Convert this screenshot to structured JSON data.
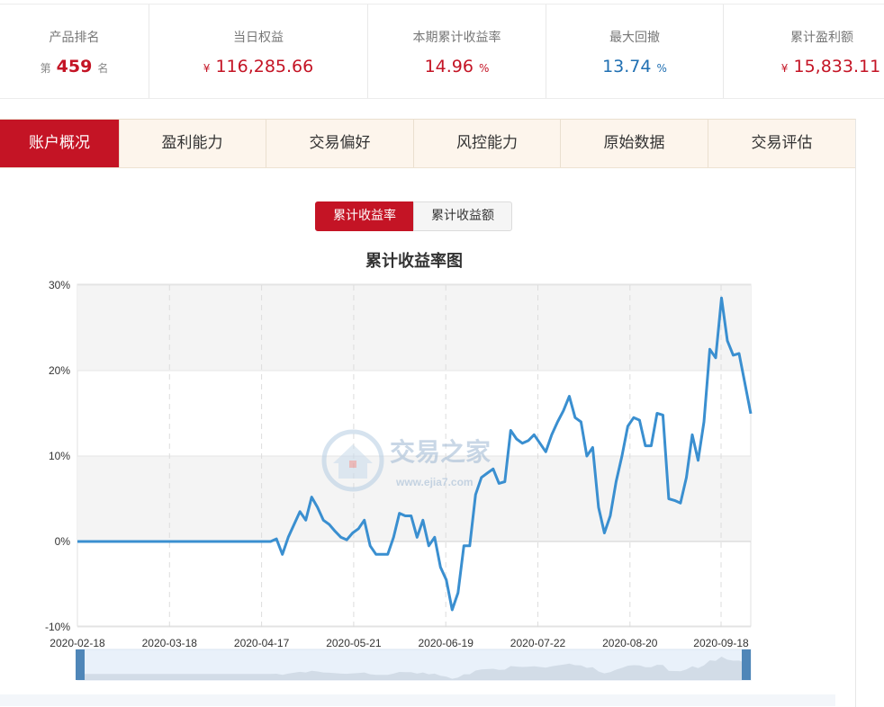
{
  "stats": {
    "rank": {
      "label": "产品排名",
      "prefix": "第",
      "value": "459",
      "suffix": "名"
    },
    "equity": {
      "label": "当日权益",
      "currency": "¥",
      "value": "116,285.66"
    },
    "cum_return": {
      "label": "本期累计收益率",
      "value": "14.96",
      "unit": "%"
    },
    "max_drawdown": {
      "label": "最大回撤",
      "value": "13.74",
      "unit": "%"
    },
    "cum_profit": {
      "label": "累计盈利额",
      "currency": "¥",
      "value": "15,833.11"
    }
  },
  "tabs": [
    "账户概况",
    "盈利能力",
    "交易偏好",
    "风控能力",
    "原始数据",
    "交易评估"
  ],
  "active_tab": 0,
  "toggle": {
    "rate": "累计收益率",
    "amount": "累计收益额"
  },
  "watermark": {
    "name": "交易之家",
    "url": "www.ejia7.com"
  },
  "colors": {
    "accent": "#c41425",
    "line": "#3a8fd0",
    "blue_value": "#1f6fb2"
  },
  "chart_data": {
    "type": "line",
    "title": "累计收益率图",
    "xlabel": "",
    "ylabel": "",
    "ylim": [
      -10,
      30
    ],
    "yticks": [
      "30%",
      "20%",
      "10%",
      "0%",
      "-10%"
    ],
    "xticks": [
      "2020-02-18",
      "2020-03-18",
      "2020-04-17",
      "2020-05-21",
      "2020-06-19",
      "2020-07-22",
      "2020-08-20",
      "2020-09-18"
    ],
    "grid": true,
    "series": [
      {
        "name": "",
        "values": [
          [
            0,
            0
          ],
          [
            33,
            0
          ],
          [
            34,
            0.3
          ],
          [
            35,
            -1.5
          ],
          [
            36,
            0.5
          ],
          [
            37,
            2
          ],
          [
            38,
            3.5
          ],
          [
            39,
            2.5
          ],
          [
            40,
            5.2
          ],
          [
            41,
            4
          ],
          [
            42,
            2.5
          ],
          [
            43,
            2
          ],
          [
            44,
            1.2
          ],
          [
            45,
            0.5
          ],
          [
            46,
            0.2
          ],
          [
            47,
            1
          ],
          [
            48,
            1.5
          ],
          [
            49,
            2.5
          ],
          [
            50,
            -0.5
          ],
          [
            51,
            -1.5
          ],
          [
            52,
            -1.5
          ],
          [
            53,
            -1.5
          ],
          [
            54,
            0.5
          ],
          [
            55,
            3.3
          ],
          [
            56,
            3
          ],
          [
            57,
            3
          ],
          [
            58,
            0.5
          ],
          [
            59,
            2.5
          ],
          [
            60,
            -0.5
          ],
          [
            61,
            0.5
          ],
          [
            62,
            -3
          ],
          [
            63,
            -4.5
          ],
          [
            64,
            -8
          ],
          [
            65,
            -6
          ],
          [
            66,
            -0.5
          ],
          [
            67,
            -0.5
          ],
          [
            68,
            5.5
          ],
          [
            69,
            7.5
          ],
          [
            70,
            8
          ],
          [
            71,
            8.5
          ],
          [
            72,
            6.8
          ],
          [
            73,
            7
          ],
          [
            74,
            13
          ],
          [
            75,
            12
          ],
          [
            76,
            11.5
          ],
          [
            77,
            11.8
          ],
          [
            78,
            12.5
          ],
          [
            79,
            11.5
          ],
          [
            80,
            10.5
          ],
          [
            81,
            12.5
          ],
          [
            82,
            14
          ],
          [
            83,
            15.3
          ],
          [
            84,
            17
          ],
          [
            85,
            14.5
          ],
          [
            86,
            14
          ],
          [
            87,
            10
          ],
          [
            88,
            11
          ],
          [
            89,
            4
          ],
          [
            90,
            1
          ],
          [
            91,
            3
          ],
          [
            92,
            7
          ],
          [
            93,
            10
          ],
          [
            94,
            13.5
          ],
          [
            95,
            14.5
          ],
          [
            96,
            14.2
          ],
          [
            97,
            11.2
          ],
          [
            98,
            11.2
          ],
          [
            99,
            15
          ],
          [
            100,
            14.8
          ],
          [
            101,
            5
          ],
          [
            102,
            4.8
          ],
          [
            103,
            4.5
          ],
          [
            104,
            7.5
          ],
          [
            105,
            12.5
          ],
          [
            106,
            9.5
          ],
          [
            107,
            14
          ],
          [
            108,
            22.5
          ],
          [
            109,
            21.5
          ],
          [
            110,
            28.5
          ],
          [
            111,
            23.5
          ],
          [
            112,
            21.8
          ],
          [
            113,
            22
          ],
          [
            114,
            18.5
          ],
          [
            115,
            14.96
          ]
        ]
      }
    ]
  }
}
